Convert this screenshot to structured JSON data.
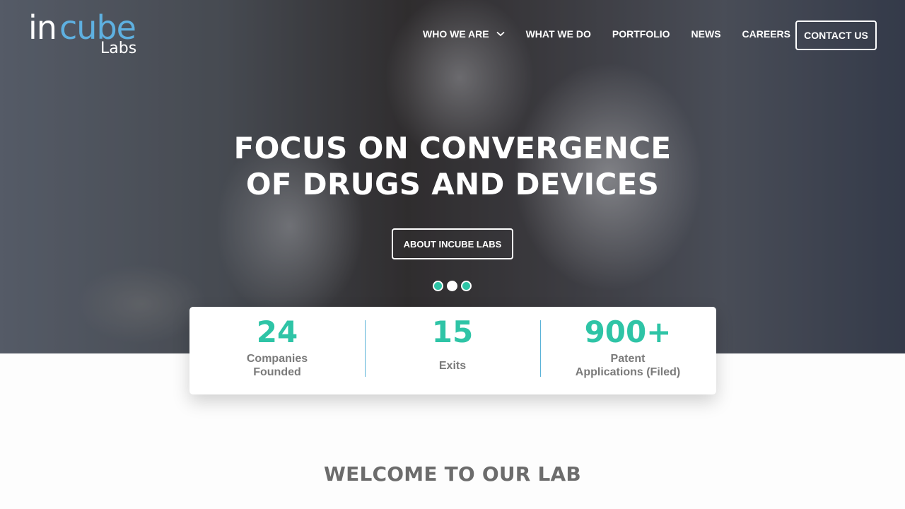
{
  "brand": {
    "logo_in": "in",
    "logo_cube": "cube",
    "logo_labs": "Labs",
    "accent": "#2ec4a6",
    "logo_blue": "#5eb0e0"
  },
  "nav": {
    "items": [
      {
        "label": "WHO WE ARE",
        "has_dropdown": true,
        "icon": "chevron-down-icon"
      },
      {
        "label": "WHAT WE DO"
      },
      {
        "label": "PORTFOLIO"
      },
      {
        "label": "NEWS"
      },
      {
        "label": "CAREERS"
      }
    ],
    "contact_label": "CONTACT US"
  },
  "hero": {
    "headline_line1": "FOCUS ON CONVERGENCE",
    "headline_line2": "OF DRUGS AND DEVICES",
    "cta_label": "ABOUT INCUBE LABS",
    "slides": {
      "count": 3,
      "active_index": 1
    }
  },
  "stats": [
    {
      "value": "24",
      "label_line1": "Companies",
      "label_line2": "Founded"
    },
    {
      "value": "15",
      "label_line1": "Exits",
      "label_line2": ""
    },
    {
      "value": "900+",
      "label_line1": "Patent",
      "label_line2": "Applications (Filed)"
    }
  ],
  "welcome": {
    "title": "WELCOME TO OUR LAB"
  }
}
